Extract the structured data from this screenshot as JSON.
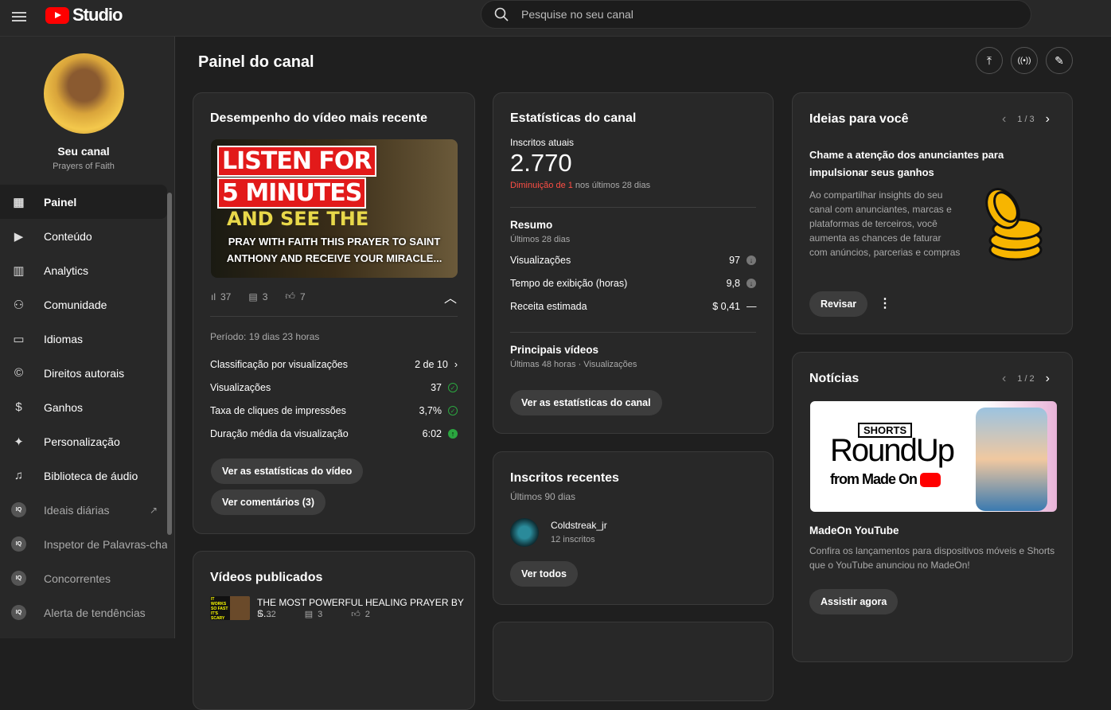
{
  "header": {
    "logo_text": "Studio",
    "search_placeholder": "Pesquise no seu canal"
  },
  "sidebar": {
    "channel_label": "Seu canal",
    "channel_name": "Prayers of Faith",
    "items": [
      {
        "label": "Painel",
        "icon": "dashboard-icon"
      },
      {
        "label": "Conteúdo",
        "icon": "content-icon"
      },
      {
        "label": "Analytics",
        "icon": "analytics-icon"
      },
      {
        "label": "Comunidade",
        "icon": "community-icon"
      },
      {
        "label": "Idiomas",
        "icon": "subtitles-icon"
      },
      {
        "label": "Direitos autorais",
        "icon": "copyright-icon"
      },
      {
        "label": "Ganhos",
        "icon": "dollar-icon"
      },
      {
        "label": "Personalização",
        "icon": "magic-wand-icon"
      },
      {
        "label": "Biblioteca de áudio",
        "icon": "audio-library-icon"
      }
    ],
    "extensions": [
      {
        "label": "Ideais diárias",
        "badge": "IQ"
      },
      {
        "label": "Inspetor de Palavras-chav",
        "badge": "IQ"
      },
      {
        "label": "Concorrentes",
        "badge": "IQ"
      },
      {
        "label": "Alerta de tendências",
        "badge": "IQ"
      }
    ]
  },
  "page": {
    "title": "Painel do canal"
  },
  "latest": {
    "title": "Desempenho do vídeo mais recente",
    "thumb_lines": [
      "LISTEN FOR",
      "5 MINUTES",
      "AND SEE THE"
    ],
    "video_title": "PRAY WITH FAITH THIS PRAYER TO SAINT ANTHONY AND RECEIVE YOUR MIRACLE...",
    "views": "37",
    "comments": "3",
    "likes": "7",
    "period": "Período: 19 dias 23 horas",
    "metrics": [
      {
        "label": "Classificação por visualizações",
        "value": "2 de 10"
      },
      {
        "label": "Visualizações",
        "value": "37"
      },
      {
        "label": "Taxa de cliques de impressões",
        "value": "3,7%"
      },
      {
        "label": "Duração média da visualização",
        "value": "6:02"
      }
    ],
    "btn_stats": "Ver as estatísticas do vídeo",
    "btn_comments": "Ver comentários (3)"
  },
  "published": {
    "title": "Vídeos publicados",
    "video_title": "THE MOST POWERFUL HEALING PRAYER BY S...",
    "views": "32",
    "comments": "3",
    "likes": "2",
    "thumb_text": "IT WORKS SO FAST IT'S SCARY"
  },
  "stats": {
    "title": "Estatísticas do canal",
    "subs_label": "Inscritos atuais",
    "subs": "2.770",
    "change_red": "Diminuição de 1",
    "change_rest": " nos últimos 28 dias",
    "summary_title": "Resumo",
    "summary_sub": "Últimos 28 dias",
    "rows": [
      {
        "label": "Visualizações",
        "value": "97"
      },
      {
        "label": "Tempo de exibição (horas)",
        "value": "9,8"
      },
      {
        "label": "Receita estimada",
        "value": "$ 0,41"
      }
    ],
    "top_title": "Principais vídeos",
    "top_sub": "Últimas 48 horas · Visualizações",
    "btn": "Ver as estatísticas do canal"
  },
  "recent": {
    "title": "Inscritos recentes",
    "sub": "Últimos 90 dias",
    "name": "Coldstreak_jr",
    "count": "12 inscritos",
    "btn": "Ver todos"
  },
  "ideas": {
    "title": "Ideias para você",
    "pager": "1 / 3",
    "headline": "Chame a atenção dos anunciantes para impulsionar seus ganhos",
    "body": "Ao compartilhar insights do seu canal com anunciantes, marcas e plataformas de terceiros, você aumenta as chances de faturar com anúncios, parcerias e compras",
    "btn": "Revisar"
  },
  "news": {
    "title": "Notícias",
    "pager": "1 / 2",
    "banner_tag": "SHORTS",
    "banner_title": "RoundUp",
    "banner_sub": "from Made On",
    "headline": "MadeOn YouTube",
    "body": "Confira os lançamentos para dispositivos móveis e Shorts que o YouTube anunciou no MadeOn!",
    "btn": "Assistir agora"
  },
  "colors": {
    "accent_red": "#ff4e45",
    "success": "#2ba640",
    "bg": "#1f1f1f",
    "card": "#282828"
  }
}
